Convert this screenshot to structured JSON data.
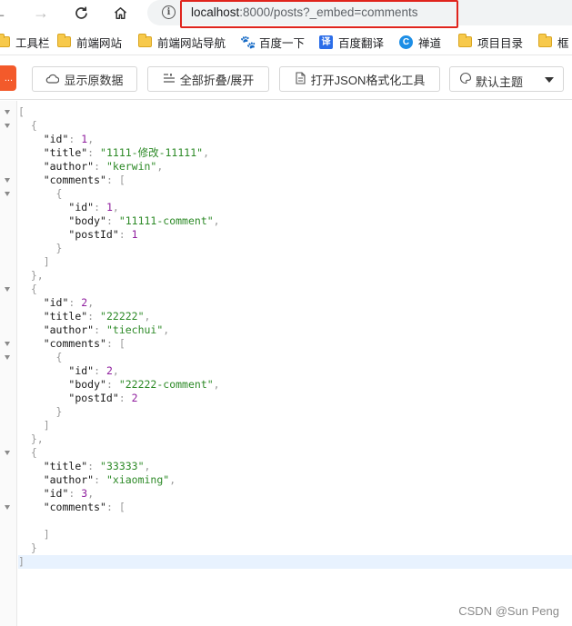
{
  "browser": {
    "url_host": "localhost",
    "url_rest": ":8000/posts?_embed=comments",
    "icons": {
      "back": "back-arrow-icon",
      "forward": "forward-arrow-icon",
      "reload": "reload-icon",
      "home": "home-icon",
      "site_info": "info-icon"
    }
  },
  "bookmarks": [
    {
      "label": "工具栏",
      "icon": "folder-icon"
    },
    {
      "label": "前端网站",
      "icon": "folder-icon"
    },
    {
      "label": "前端网站导航",
      "icon": "folder-icon"
    },
    {
      "label": "百度一下",
      "icon": "baidu-icon"
    },
    {
      "label": "百度翻译",
      "icon": "translate-icon"
    },
    {
      "label": "禅道",
      "icon": "chandao-icon"
    },
    {
      "label": "项目目录",
      "icon": "folder-icon"
    },
    {
      "label": "框",
      "icon": "folder-icon"
    }
  ],
  "toolbar": {
    "orange_tab": "...",
    "raw_label": "显示原数据",
    "fold_label": "全部折叠/展开",
    "json_tool_label": "打开JSON格式化工具",
    "theme_label": "默认主题"
  },
  "json_lines": [
    "[",
    "  {",
    "    \"id\": 1,",
    "    \"title\": \"1111-修改-11111\",",
    "    \"author\": \"kerwin\",",
    "    \"comments\": [",
    "      {",
    "        \"id\": 1,",
    "        \"body\": \"11111-comment\",",
    "        \"postId\": 1",
    "      }",
    "    ]",
    "  },",
    "  {",
    "    \"id\": 2,",
    "    \"title\": \"22222\",",
    "    \"author\": \"tiechui\",",
    "    \"comments\": [",
    "      {",
    "        \"id\": 2,",
    "        \"body\": \"22222-comment\",",
    "        \"postId\": 2",
    "      }",
    "    ]",
    "  },",
    "  {",
    "    \"title\": \"33333\",",
    "    \"author\": \"xiaoming\",",
    "    \"id\": 3,",
    "    \"comments\": [",
    "",
    "    ]",
    "  }",
    "]"
  ],
  "watermark": "CSDN @Sun   Peng",
  "colors": {
    "key": "#1a1a1a",
    "string": "#2d8a27",
    "number": "#8f1e9e",
    "punctuation": "#999999",
    "highlight_box": "#e0241c",
    "active_line": "#e8f2fe"
  }
}
